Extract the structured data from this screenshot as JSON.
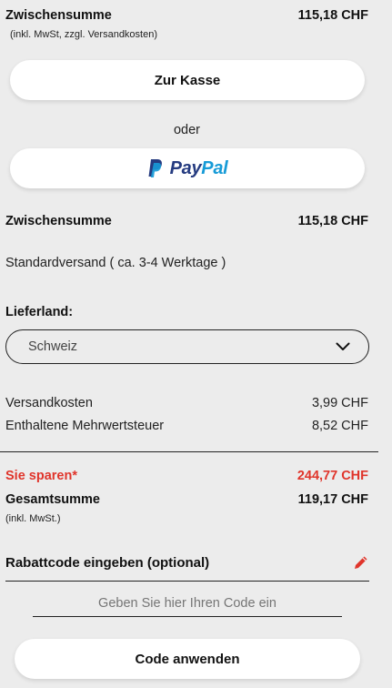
{
  "summary_top": {
    "label": "Zwischensumme",
    "value": "115,18 CHF",
    "note": "(inkl. MwSt, zzgl. Versandkosten)"
  },
  "checkout_button": {
    "label": "Zur Kasse"
  },
  "or_text": "oder",
  "paypal_button": {
    "word1": "Pay",
    "word2": "Pal"
  },
  "subtotal": {
    "label": "Zwischensumme",
    "value": "115,18 CHF"
  },
  "shipping_method": "Standardversand ( ca. 3-4 Werktage )",
  "country": {
    "label": "Lieferland:",
    "selected": "Schweiz"
  },
  "costs": [
    {
      "label": "Versandkosten",
      "value": "3,99 CHF"
    },
    {
      "label": "Enthaltene Mehrwertsteuer",
      "value": "8,52 CHF"
    }
  ],
  "savings": {
    "label": "Sie sparen*",
    "value": "244,77 CHF"
  },
  "total": {
    "label": "Gesamtsumme",
    "value": "119,17 CHF",
    "note": "(inkl. MwSt.)"
  },
  "discount": {
    "title": "Rabattcode eingeben (optional)",
    "placeholder": "Geben Sie hier Ihren Code ein",
    "apply_label": "Code anwenden"
  },
  "colors": {
    "accent_red": "#e0352b",
    "paypal_dark": "#253b80",
    "paypal_light": "#179bd7"
  }
}
